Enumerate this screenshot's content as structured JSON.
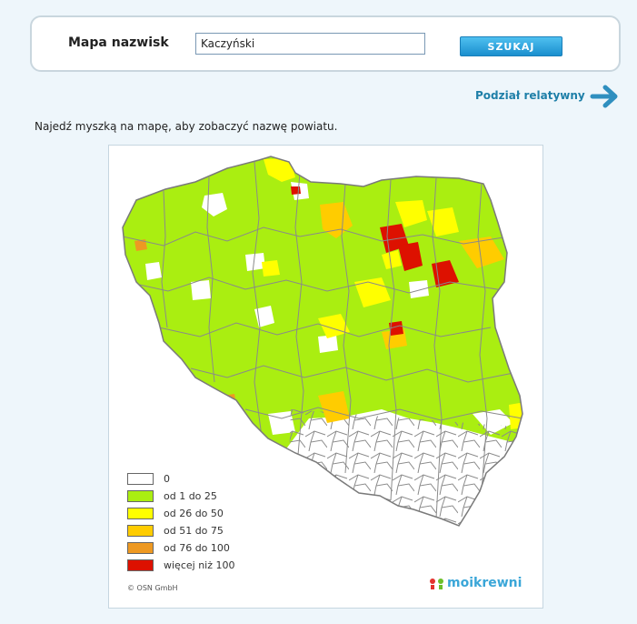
{
  "search": {
    "title": "Mapa nazwisk",
    "input_value": "Kaczyński",
    "button_label": "SZUKAJ"
  },
  "relative_link": {
    "label": "Podział relatywny",
    "icon": "arrow-right-icon"
  },
  "hint": "Najedź myszką na mapę, aby zobaczyć nazwę powiatu.",
  "map": {
    "legend": [
      {
        "label": "0",
        "color": "#ffffff"
      },
      {
        "label": "od 1 do 25",
        "color": "#aaee11"
      },
      {
        "label": "od 26 do 50",
        "color": "#ffff00"
      },
      {
        "label": "od 51 do 75",
        "color": "#ffcc00"
      },
      {
        "label": "od 76 do 100",
        "color": "#ee9922"
      },
      {
        "label": "więcej niż 100",
        "color": "#dd1100"
      }
    ],
    "copyright": "© OSN GmbH",
    "brand": "moikrewni",
    "brand_logo": "moikrewni-logo-icon"
  },
  "colors": {
    "page_bg": "#eef6fb",
    "accent": "#1e7fa8",
    "button": "#1a8fce",
    "region_border": "#8a8a8a"
  }
}
